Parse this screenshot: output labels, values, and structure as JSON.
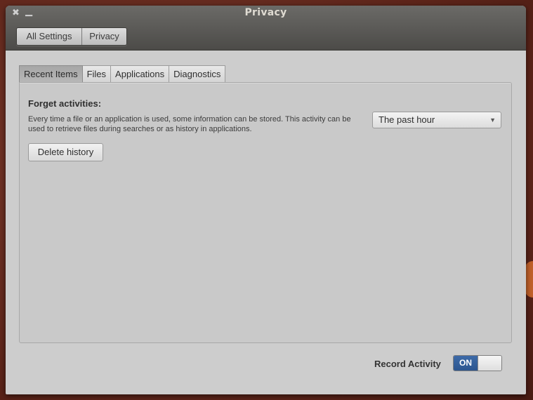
{
  "window": {
    "title": "Privacy",
    "close_glyph": "✖",
    "minimize_glyph": "▁"
  },
  "breadcrumb": [
    "All Settings",
    "Privacy"
  ],
  "tabs": [
    {
      "label": "Recent Items",
      "active": true
    },
    {
      "label": "Files",
      "active": false
    },
    {
      "label": "Applications",
      "active": false
    },
    {
      "label": "Diagnostics",
      "active": false
    }
  ],
  "forget": {
    "title": "Forget activities:",
    "description": "Every time a file or an application is used, some information can be stored. This activity can be used to retrieve files during searches or as history in applications.",
    "selected_option": "The past hour",
    "delete_button": "Delete history"
  },
  "record_activity": {
    "label": "Record Activity",
    "state": "ON"
  },
  "colors": {
    "switch_on": "#3d6aa8",
    "titlebar": "#5a5956"
  }
}
